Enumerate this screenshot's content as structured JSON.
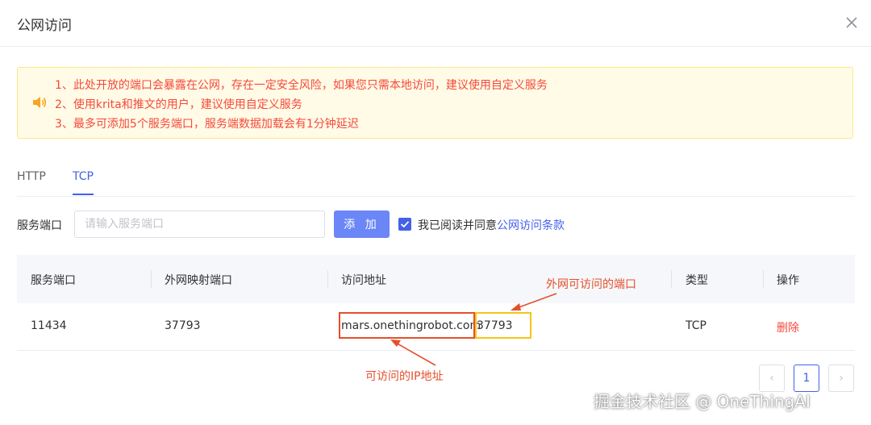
{
  "dialog": {
    "title": "公网访问"
  },
  "warning": {
    "lines": [
      "1、此处开放的端口会暴露在公网，存在一定安全风险，如果您只需本地访问，建议使用自定义服务",
      "2、使用krita和推文的用户，建议使用自定义服务",
      "3、最多可添加5个服务端口，服务端数据加载会有1分钟延迟"
    ]
  },
  "tabs": [
    "HTTP",
    "TCP"
  ],
  "active_tab": "TCP",
  "form": {
    "label": "服务端口",
    "placeholder": "请输入服务端口",
    "add_label": "添 加",
    "agree_text": "我已阅读并同意",
    "agree_link": "公网访问条款",
    "checked": true
  },
  "table": {
    "headers": [
      "服务端口",
      "外网映射端口",
      "访问地址",
      "类型",
      "操作"
    ],
    "rows": [
      {
        "service_port": "11434",
        "mapped_port": "37793",
        "host": "mars.onethingrobot.com",
        "host_port": "37793",
        "type": "TCP",
        "action": "删除"
      }
    ]
  },
  "annotations": {
    "port": "外网可访问的端口",
    "ip": "可访问的IP地址"
  },
  "pagination": {
    "prev": "‹",
    "current": "1",
    "next": "›"
  },
  "watermark": "掘金技术社区 @ OneThingAI",
  "colors": {
    "primary": "#4461e8",
    "danger": "#f5493c",
    "annotation": "#e5502c",
    "highlight": "#f5c518",
    "warning_bg": "#fffbe6"
  }
}
